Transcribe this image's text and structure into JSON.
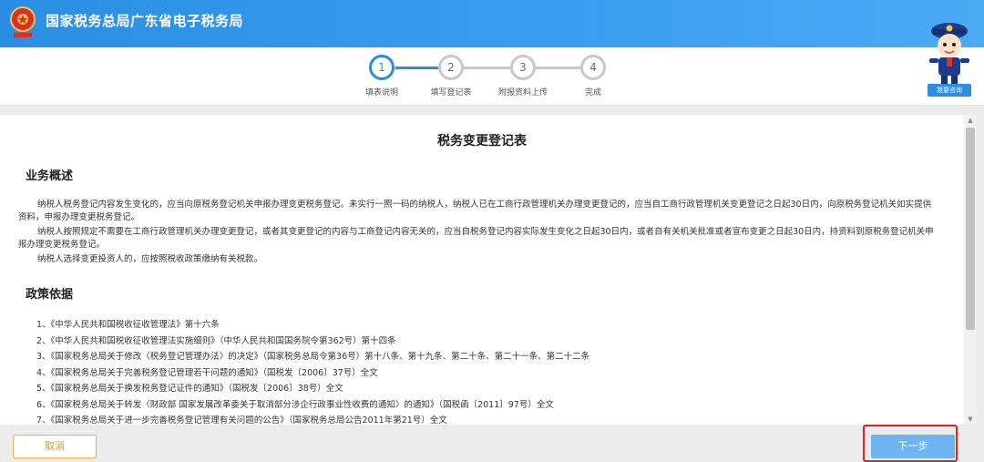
{
  "header": {
    "title": "国家税务总局广东省电子税务局"
  },
  "steps": [
    {
      "number": "1",
      "label": "填表说明",
      "active": true
    },
    {
      "number": "2",
      "label": "填写登记表",
      "active": false
    },
    {
      "number": "3",
      "label": "附报资料上传",
      "active": false
    },
    {
      "number": "4",
      "label": "完成",
      "active": false
    }
  ],
  "help": {
    "label": "我要咨询"
  },
  "document": {
    "title": "税务变更登记表",
    "overview_heading": "业务概述",
    "overview_paragraphs": [
      "纳税人税务登记内容发生变化的，应当向原税务登记机关申报办理变更税务登记。未实行一照一码的纳税人，纳税人已在工商行政管理机关办理变更登记的，应当自工商行政管理机关变更登记之日起30日内，向原税务登记机关如实提供资料，申报办理变更税务登记。",
      "纳税人按照规定不需要在工商行政管理机关办理变更登记，或者其变更登记的内容与工商登记内容无关的，应当自税务登记内容实际发生变化之日起30日内，或者自有关机关批准或者宣布变更之日起30日内，持资料到原税务登记机关申报办理变更税务登记。",
      "纳税人选择变更投资人的，应按照税收政策缴纳有关税款。"
    ],
    "policy_heading": "政策依据",
    "policies": [
      "1、《中华人民共和国税收征收管理法》第十六条",
      "2、《中华人民共和国税收征收管理法实施细则》（中华人民共和国国务院令第362号）第十四条",
      "3、《国家税务总局关于修改〈税务登记管理办法〉的决定》（国家税务总局令第36号）第十八条、第十九条、第二十条、第二十一条、第二十二条",
      "4、《国家税务总局关于完善税务登记管理若干问题的通知》（国税发〔2006〕37号）全文",
      "5、《国家税务总局关于换发税务登记证件的通知》（国税发〔2006〕38号）全文",
      "6、《国家税务总局关于转发〈财政部 国家发展改革委关于取消部分涉企行政事业性收费的通知〉的通知》（国税函〔2011〕97号）全文",
      "7、《国家税务总局关于进一步完善税务登记管理有关问题的公告》（国家税务总局公告2011年第21号）全文"
    ]
  },
  "footer": {
    "cancel_label": "取消",
    "next_label": "下一步"
  },
  "colors": {
    "primary": "#2a8ee3",
    "next_button": "#6eb4f0",
    "cancel_border": "#f0b050",
    "highlight": "#e52222"
  }
}
